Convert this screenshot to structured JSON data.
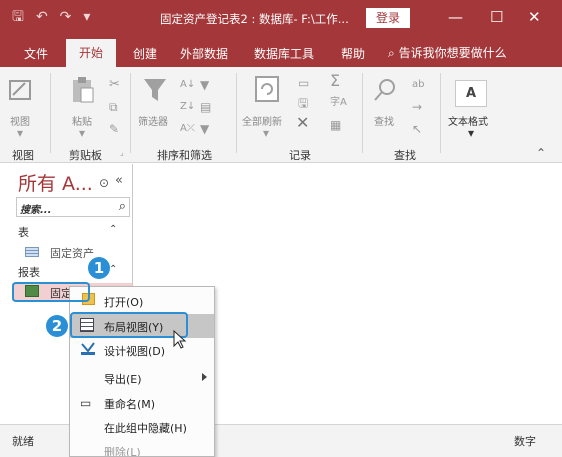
{
  "window": {
    "title": "固定资产登记表2 : 数据库- F:\\工作...",
    "login_label": "登录",
    "minimize": "—",
    "restore": "☐",
    "close": "✕"
  },
  "menu": {
    "tabs": [
      "文件",
      "开始",
      "创建",
      "外部数据",
      "数据库工具",
      "帮助"
    ],
    "active_tab": "开始",
    "tell_me": "告诉我你想要做什么"
  },
  "ribbon": {
    "buttons": {
      "view": "视图",
      "paste": "粘贴",
      "filter": "筛选器",
      "refresh_all": "全部刷新",
      "find": "查找",
      "text_format": "文本格式",
      "text_format_glyph": "A"
    },
    "groups": {
      "views": "视图",
      "clipboard": "剪贴板",
      "sort_filter": "排序和筛选",
      "records": "记录",
      "find": "查找"
    }
  },
  "nav_pane": {
    "title": "所有 A...",
    "search_placeholder": "搜索...",
    "sections": [
      {
        "label": "表",
        "items": [
          "固定资产"
        ]
      },
      {
        "label": "报表",
        "items": [
          "固定资产"
        ]
      }
    ]
  },
  "context_menu": {
    "items": [
      {
        "label": "打开(O)",
        "highlighted": false,
        "submenu": false
      },
      {
        "label": "布局视图(Y)",
        "highlighted": true,
        "submenu": false
      },
      {
        "label": "设计视图(D)",
        "highlighted": false,
        "submenu": false
      },
      {
        "label": "导出(E)",
        "highlighted": false,
        "submenu": true
      },
      {
        "label": "重命名(M)",
        "highlighted": false,
        "submenu": false
      },
      {
        "label": "在此组中隐藏(H)",
        "highlighted": false,
        "submenu": false
      },
      {
        "label": "删除(L)",
        "highlighted": false,
        "submenu": false
      }
    ]
  },
  "callouts": {
    "step1": "1",
    "step2": "2"
  },
  "status": {
    "left": "就绪",
    "right": "数字"
  },
  "colors": {
    "accent": "#a4373a",
    "callout": "#2b8fd6"
  }
}
